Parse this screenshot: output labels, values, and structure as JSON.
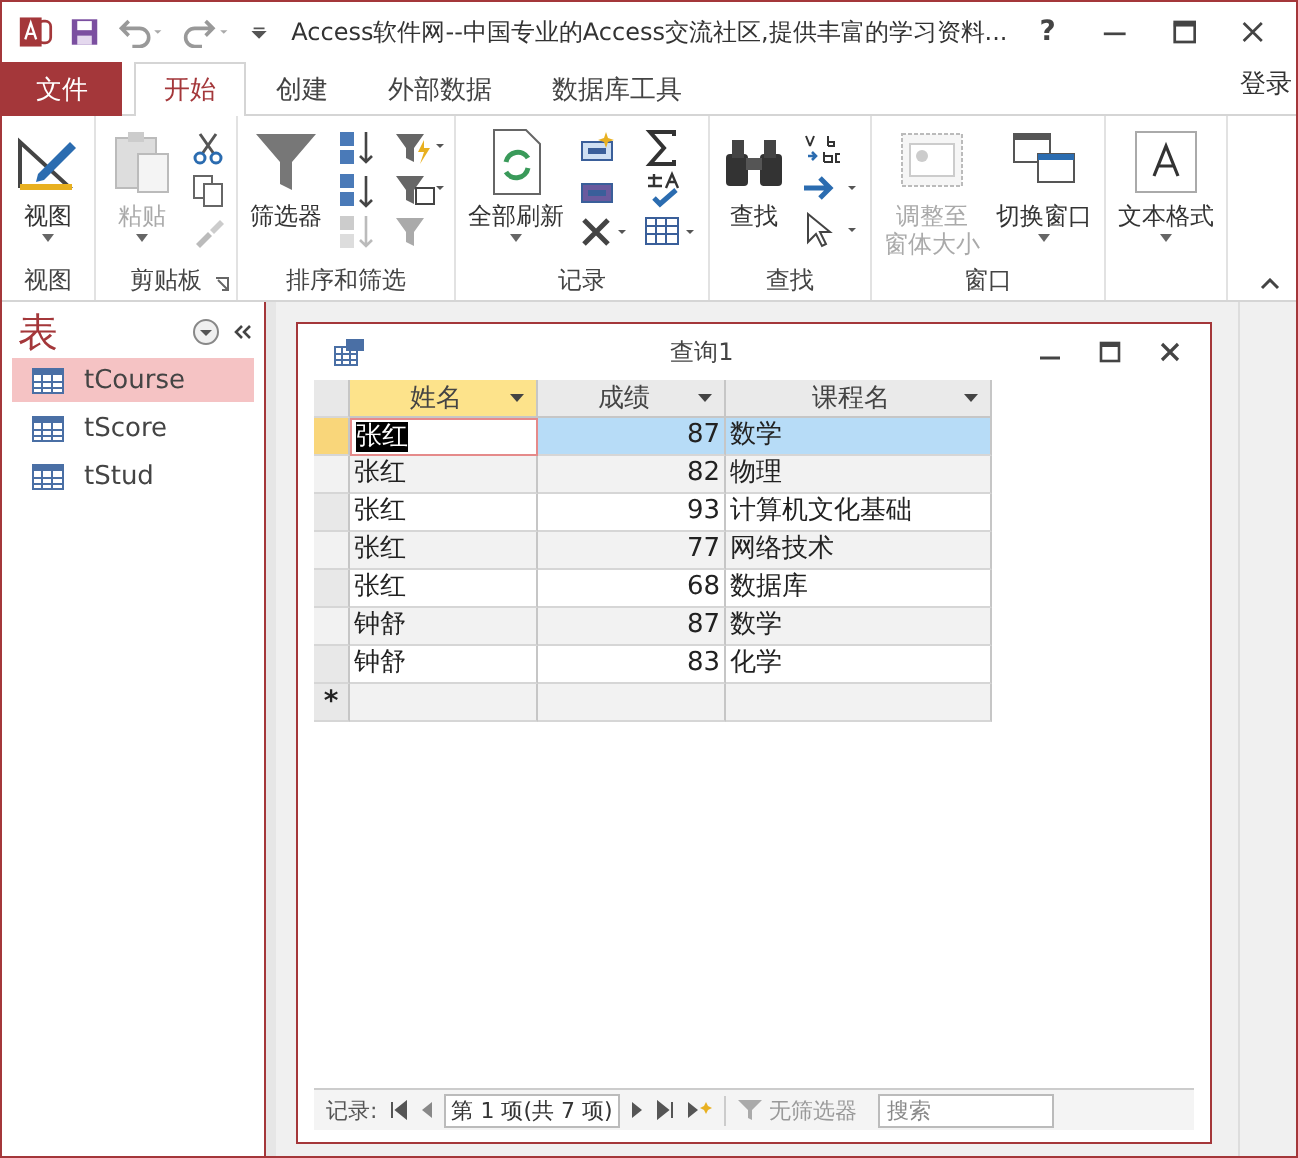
{
  "window": {
    "title": "Access软件网--中国专业的Access交流社区,提供丰富的学习资料...",
    "help": "?",
    "sign_in": "登录"
  },
  "ribbon_tabs": [
    {
      "label": "文件",
      "kind": "file",
      "selected": false
    },
    {
      "label": "开始",
      "kind": "tab",
      "selected": true
    },
    {
      "label": "创建",
      "kind": "tab",
      "selected": false
    },
    {
      "label": "外部数据",
      "kind": "tab",
      "selected": false
    },
    {
      "label": "数据库工具",
      "kind": "tab",
      "selected": false
    }
  ],
  "ribbon_groups": [
    {
      "label": "视图",
      "launcher": false,
      "buttons": [
        {
          "label": "视图",
          "kind": "large",
          "disabled": false,
          "dropdown": true
        }
      ]
    },
    {
      "label": "剪贴板",
      "launcher": true,
      "buttons": [
        {
          "label": "粘贴",
          "kind": "large",
          "disabled": true,
          "dropdown": true
        }
      ]
    },
    {
      "label": "排序和筛选",
      "launcher": false,
      "buttons": [
        {
          "label": "筛选器",
          "kind": "large",
          "disabled": false,
          "dropdown": false
        }
      ]
    },
    {
      "label": "记录",
      "launcher": false,
      "buttons": [
        {
          "label": "全部刷新",
          "kind": "large",
          "disabled": false,
          "dropdown": true
        }
      ]
    },
    {
      "label": "查找",
      "launcher": false,
      "buttons": [
        {
          "label": "查找",
          "kind": "large",
          "disabled": false,
          "dropdown": false
        }
      ]
    },
    {
      "label": "窗口",
      "launcher": false,
      "buttons": [
        {
          "label": "调整至窗体大小",
          "kind": "two-line",
          "disabled": true,
          "dropdown": false
        },
        {
          "label": "切换窗口",
          "kind": "large",
          "disabled": false,
          "dropdown": true
        }
      ]
    },
    {
      "launcher": false,
      "buttons": [
        {
          "label": "文本格式",
          "kind": "large",
          "disabled": false,
          "dropdown": true
        }
      ]
    }
  ],
  "nav_pane": {
    "title": "表",
    "items": [
      {
        "label": "tCourse",
        "selected": true
      },
      {
        "label": "tScore",
        "selected": false
      },
      {
        "label": "tStud",
        "selected": false
      }
    ]
  },
  "query_window": {
    "title": "查询1",
    "columns": [
      {
        "label": "姓名",
        "kind": "text",
        "selected": true
      },
      {
        "label": "成绩",
        "kind": "number",
        "selected": false
      },
      {
        "label": "课程名",
        "kind": "text",
        "selected": false
      }
    ],
    "rows": [
      {
        "cells": [
          "张红",
          "87",
          "数学"
        ],
        "selected": true
      },
      {
        "cells": [
          "张红",
          "82",
          "物理"
        ],
        "selected": false
      },
      {
        "cells": [
          "张红",
          "93",
          "计算机文化基础"
        ],
        "selected": false
      },
      {
        "cells": [
          "张红",
          "77",
          "网络技术"
        ],
        "selected": false
      },
      {
        "cells": [
          "张红",
          "68",
          "数据库"
        ],
        "selected": false
      },
      {
        "cells": [
          "钟舒",
          "87",
          "数学"
        ],
        "selected": false
      },
      {
        "cells": [
          "钟舒",
          "83",
          "化学"
        ],
        "selected": false
      }
    ],
    "new_row_marker": "*",
    "status_bar": {
      "label": "记录:",
      "position": "第 1 项(共 7 项)",
      "filter": "无筛选器",
      "search": "搜索"
    }
  }
}
